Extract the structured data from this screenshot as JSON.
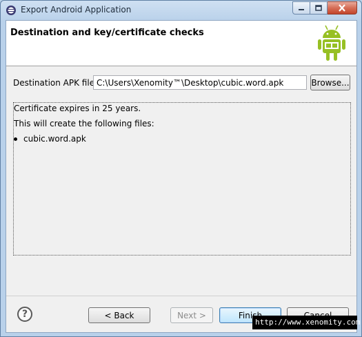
{
  "window": {
    "title": "Export Android Application"
  },
  "header": {
    "title": "Destination and key/certificate checks"
  },
  "destination": {
    "label": "Destination APK file:",
    "value": "C:\\Users\\Xenomity™\\Desktop\\cubic.word.apk",
    "browse_label": "Browse..."
  },
  "info": {
    "line1": "Certificate expires in 25 years.",
    "line2": "This will create the following files:",
    "files": [
      "cubic.word.apk"
    ]
  },
  "buttons": {
    "back": "< Back",
    "next": "Next >",
    "finish": "Finish",
    "cancel": "Cancel"
  },
  "watermark": "http://www.xenomity.com",
  "colors": {
    "android_green": "#97c024",
    "titlebar": "#b9d1ea",
    "close_button": "#c2452b"
  }
}
